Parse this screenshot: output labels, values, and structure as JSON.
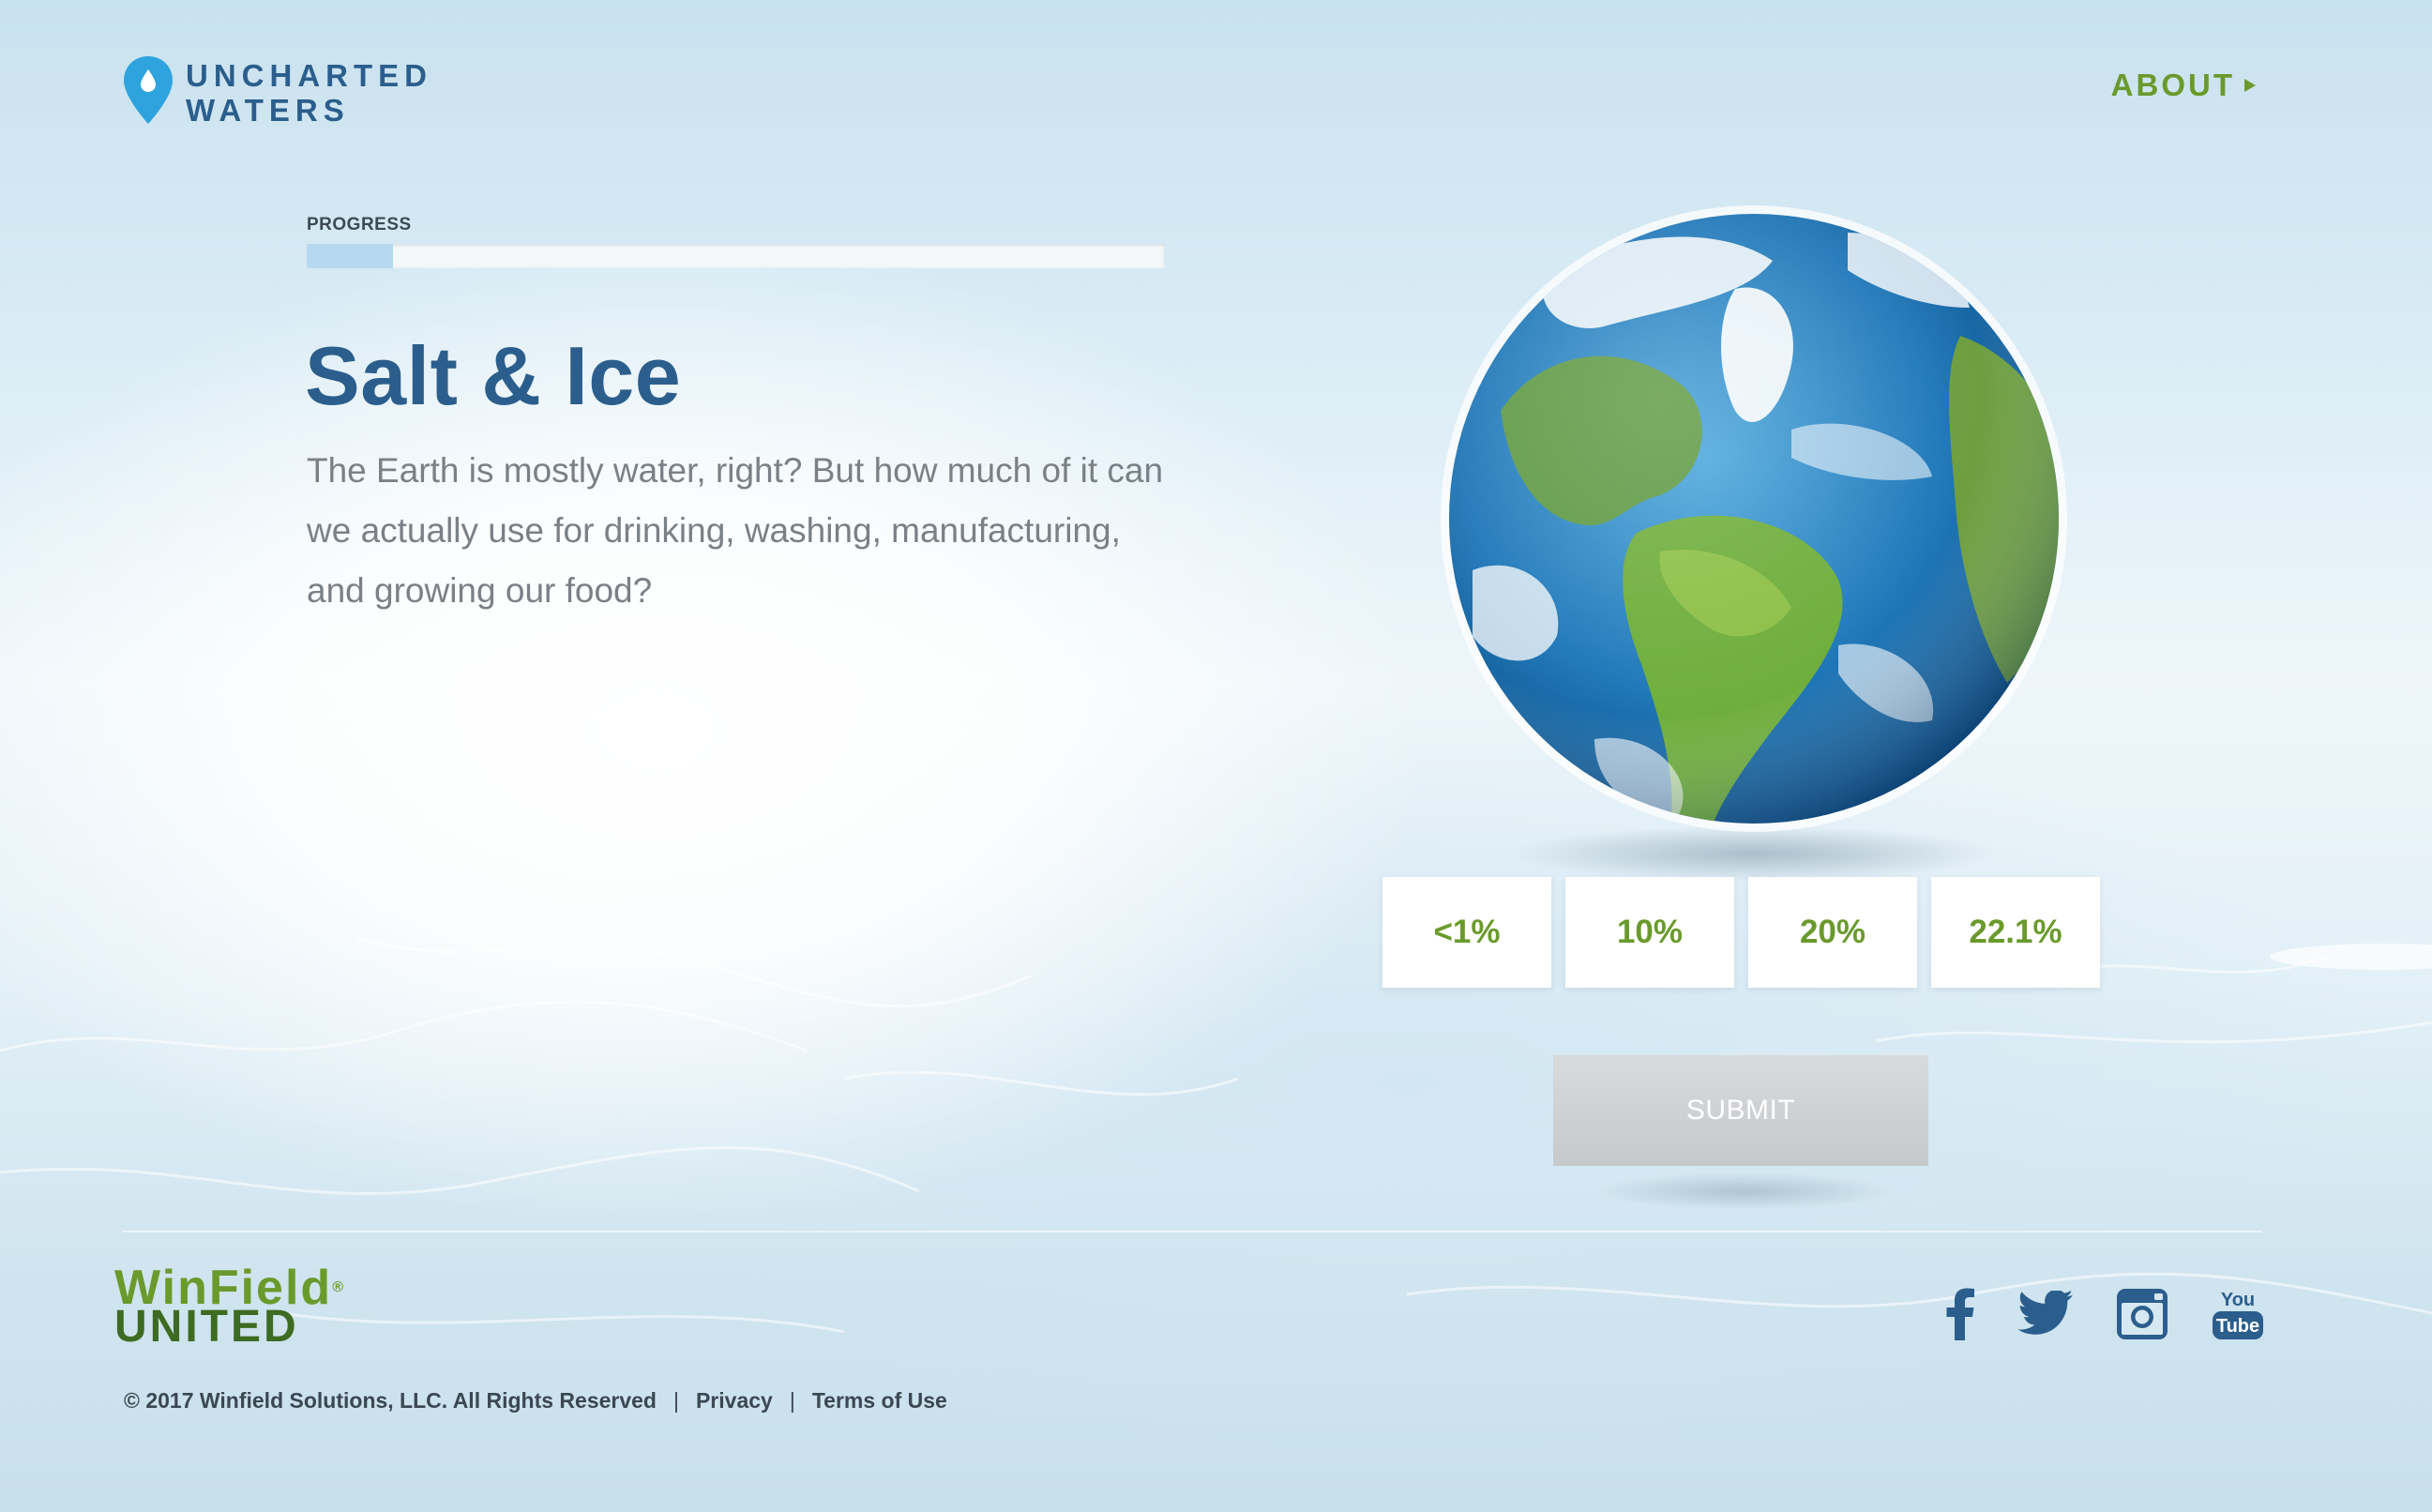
{
  "header": {
    "logo_line1": "UNCHARTED",
    "logo_line2": "WATERS",
    "about_label": "ABOUT"
  },
  "progress": {
    "label": "PROGRESS",
    "fraction": 0.1
  },
  "question": {
    "title": "Salt & Ice",
    "body": "The Earth is mostly water, right? But how much of it can we actually use for drinking, washing, manufacturing, and growing our food?"
  },
  "answers": [
    "<1%",
    "10%",
    "20%",
    "22.1%"
  ],
  "submit_label": "SUBMIT",
  "footer": {
    "brand_line1": "WinField",
    "brand_reg": "®",
    "brand_line2": "UNITED",
    "copyright": "© 2017 Winfield Solutions, LLC. All Rights Reserved",
    "sep": "|",
    "privacy": "Privacy",
    "terms": "Terms of Use",
    "youtube_you": "You",
    "youtube_tube": "Tube"
  },
  "colors": {
    "accent_green": "#6a9a2c",
    "brand_blue": "#2b5e8c",
    "pin_blue": "#2ea3dd"
  },
  "icons": [
    "pin-drop-icon",
    "arrow-right-icon",
    "facebook-icon",
    "twitter-icon",
    "instagram-icon",
    "youtube-icon"
  ]
}
